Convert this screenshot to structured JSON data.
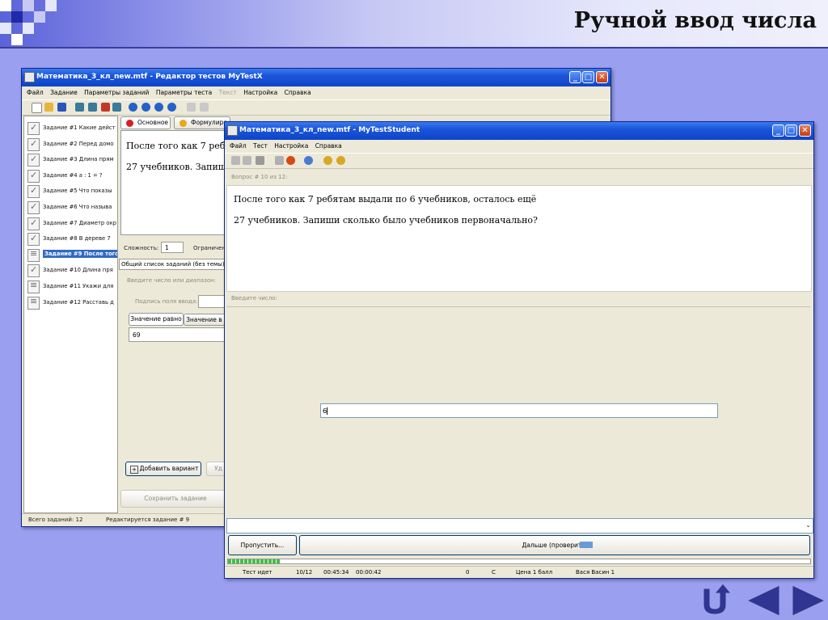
{
  "slide": {
    "title": "Ручной ввод числа"
  },
  "colors": {
    "xp_title": "#0e45c8",
    "selection": "#316ac5",
    "progress": "#3fbf3f",
    "nav_arrow": "#2f3590"
  },
  "editor": {
    "title": "Математика_3_кл_new.mtf - Редактор тестов MyTestX",
    "menu": [
      "Файл",
      "Задание",
      "Параметры заданий",
      "Параметры теста",
      "Текст",
      "Настройка",
      "Справка"
    ],
    "tasks": [
      {
        "label": "Задание #1 Какие дейст",
        "selected": false,
        "icon": "check-icon"
      },
      {
        "label": "Задание #2 Перед домо",
        "selected": false,
        "icon": "check-icon"
      },
      {
        "label": "Задание #3 Длина прям",
        "selected": false,
        "icon": "check-icon"
      },
      {
        "label": "Задание #4 a : 1 = ?",
        "selected": false,
        "icon": "check-icon"
      },
      {
        "label": "Задание #5 Что показы",
        "selected": false,
        "icon": "check-icon"
      },
      {
        "label": "Задание #6 Что называ",
        "selected": false,
        "icon": "check-icon"
      },
      {
        "label": "Задание #7 Диаметр окр",
        "selected": false,
        "icon": "check-icon"
      },
      {
        "label": "Задание #8 В дереве 7",
        "selected": false,
        "icon": "check-icon"
      },
      {
        "label": "Задание #9 После того",
        "selected": true,
        "icon": "number-icon"
      },
      {
        "label": "Задание #10 Длина пря",
        "selected": false,
        "icon": "check-icon"
      },
      {
        "label": "Задание #11 Укажи для",
        "selected": false,
        "icon": "list-icon"
      },
      {
        "label": "Задание #12 Расставь д",
        "selected": false,
        "icon": "doc-icon"
      }
    ],
    "tab_main": "Основное",
    "tab_formulation": "Формулиро",
    "question_line1": "После того как 7 ребя",
    "question_line2": "27 учебников. Запиши",
    "difficulty_label": "Сложность:",
    "difficulty_value": "1",
    "limit_label": "Ограничен",
    "list_select": "Общий список заданий (без темы)",
    "enter_number_label": "Введите число или диапазон:",
    "field_caption_label": "Подпись поля ввода:",
    "tab_equal": "Значение равно",
    "tab_range": "Значение в п",
    "answer_value": "69",
    "add_variant": "Добавить вариант",
    "delete_btn": "Уд",
    "save_task": "Сохранить задание",
    "status_total": "Всего заданий: 12",
    "status_editing": "Редактируется задание # 9"
  },
  "student": {
    "title": "Математика_3_кл_new.mtf - MyTestStudent",
    "menu": [
      "Файл",
      "Тест",
      "Настройка",
      "Справка"
    ],
    "question_header": "Вопрос # 10 из 12:",
    "question_line1": "После того как 7 ребятам выдали по 6 учебников, осталось ещё",
    "question_line2": "27 учебников. Запиши сколько было учебников первоначально?",
    "enter_number_caption": "Введите число:",
    "answer_value": "6",
    "skip_button": "Пропустить...",
    "next_button": "Дальше (проверить)",
    "status": [
      "Тест идет",
      "10/12",
      "00:45:34",
      "00:00:42",
      "0",
      "С",
      "Цена 1 балл",
      "Вася Васин 1"
    ]
  }
}
